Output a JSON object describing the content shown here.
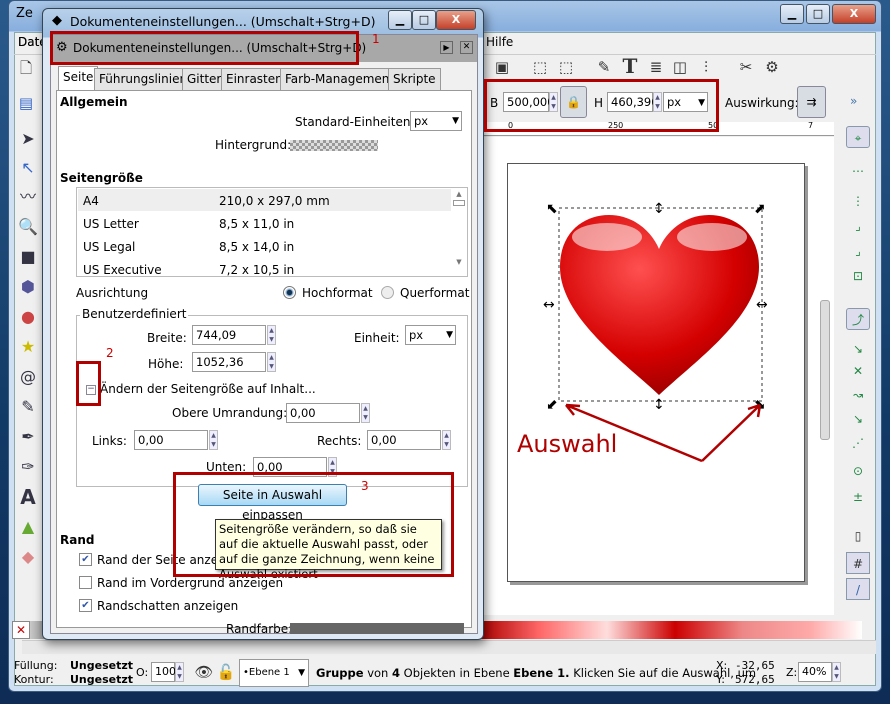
{
  "main_window": {
    "title": "Ze",
    "menu": [
      "Datei",
      "Hilfe"
    ],
    "menu_hidden_partial": "Date",
    "menu_help": "Hilfe"
  },
  "toolbar_controls": {
    "b_label": "B",
    "b_value": "500,000",
    "h_label": "H",
    "h_value": "460,396",
    "unit": "px",
    "effect_label": "Auswirkung:",
    "more": "»"
  },
  "ruler": {
    "ticks": [
      "0",
      "250",
      "50",
      "7"
    ]
  },
  "dialog": {
    "title": "Dokumenteneinstellungen... (Umschalt+Strg+D)",
    "docked_title": "Dokumenteneinstellungen... (Umschalt+Strg+D)",
    "tabs": [
      "Seite",
      "Führungslinien",
      "Gitter",
      "Einrasten",
      "Farb-Management",
      "Skripte"
    ],
    "general": {
      "heading": "Allgemein",
      "units_label": "Standard-Einheiten:",
      "units_value": "px",
      "background_label": "Hintergrund:"
    },
    "page_size": {
      "heading": "Seitengröße",
      "rows": [
        {
          "name": "A4",
          "size": "210,0 x 297,0 mm"
        },
        {
          "name": "US Letter",
          "size": "8,5 x 11,0 in"
        },
        {
          "name": "US Legal",
          "size": "8,5 x 14,0 in"
        },
        {
          "name": "US Executive",
          "size": "7,2 x 10,5 in"
        }
      ]
    },
    "orientation": {
      "label": "Ausrichtung",
      "portrait": "Hochformat",
      "landscape": "Querformat",
      "selected": "Hochformat"
    },
    "custom": {
      "legend": "Benutzerdefiniert",
      "width_label": "Breite:",
      "width_value": "744,09",
      "height_label": "Höhe:",
      "height_value": "1052,36",
      "unit_label": "Einheit:",
      "unit_value": "px",
      "resize_expander": "Ändern der Seitengröße auf Inhalt...",
      "top_label": "Obere Umrandung:",
      "top_value": "0,00",
      "left_label": "Links:",
      "left_value": "0,00",
      "right_label": "Rechts:",
      "right_value": "0,00",
      "bottom_label": "Unten:",
      "bottom_value": "0,00",
      "fit_button": "Seite in Auswahl einpassen"
    },
    "tooltip": "Seitengröße verändern, so daß sie auf die aktuelle Auswahl passt, oder auf die ganze Zeichnung, wenn keine Auswahl existiert",
    "border": {
      "heading": "Rand",
      "show_border": "Rand der Seite anzeigen",
      "show_border_checked": true,
      "border_on_top": "Rand im Vordergrund anzeigen",
      "border_on_top_checked": false,
      "shadow": "Randschatten anzeigen",
      "shadow_checked": true,
      "color_label": "Randfarbe:",
      "color": "#666666"
    }
  },
  "annotations": {
    "n1": "1",
    "n2": "2",
    "n3": "3",
    "selection_label": "Auswahl",
    "color": "#b00000"
  },
  "statusbar": {
    "fill_label": "Füllung:",
    "fill_value": "Ungesetzt",
    "stroke_label": "Kontur:",
    "stroke_value": "Ungesetzt",
    "opacity_label": "O:",
    "opacity_value": "100",
    "layer": "•Ebene 1",
    "message_bold1": "Gruppe",
    "message_1": " von ",
    "message_bold2": "4",
    "message_2": " Objekten in Ebene ",
    "message_bold3": "Ebene 1.",
    "message_3": " Klicken Sie auf die Auswahl, um",
    "x_label": "X:",
    "x_value": "-32,65",
    "y_label": "Y:",
    "y_value": "572,65",
    "zoom_label": "Z:",
    "zoom_value": "40%"
  },
  "colors": {
    "heart": "#d40000",
    "accent": "#b00000"
  }
}
